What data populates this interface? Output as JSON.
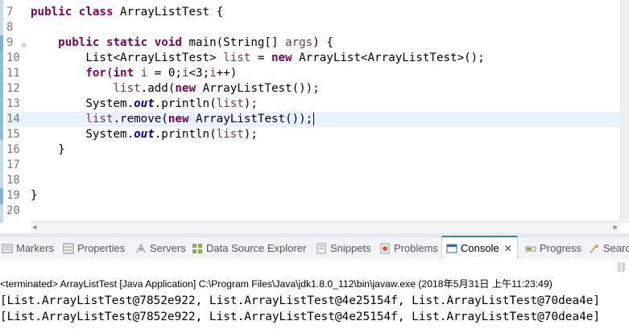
{
  "editor": {
    "lines": [
      {
        "num": "7",
        "segments": [
          {
            "t": "public class ",
            "c": "kw"
          },
          {
            "t": "ArrayListTest {",
            "c": ""
          }
        ]
      },
      {
        "num": "8",
        "segments": []
      },
      {
        "num": "9",
        "segments": [
          {
            "t": "    ",
            "c": ""
          },
          {
            "t": "public static void ",
            "c": "kw"
          },
          {
            "t": "main(String[] ",
            "c": ""
          },
          {
            "t": "args",
            "c": "var"
          },
          {
            "t": ") {",
            "c": ""
          }
        ],
        "fold": "⊖"
      },
      {
        "num": "10",
        "segments": [
          {
            "t": "        List<ArrayListTest> ",
            "c": ""
          },
          {
            "t": "list",
            "c": "var"
          },
          {
            "t": " = ",
            "c": ""
          },
          {
            "t": "new ",
            "c": "kw"
          },
          {
            "t": "ArrayList<ArrayListTest>();",
            "c": ""
          }
        ]
      },
      {
        "num": "11",
        "segments": [
          {
            "t": "        ",
            "c": ""
          },
          {
            "t": "for",
            "c": "kw"
          },
          {
            "t": "(",
            "c": ""
          },
          {
            "t": "int ",
            "c": "kw"
          },
          {
            "t": "i",
            "c": "var"
          },
          {
            "t": " = 0;",
            "c": ""
          },
          {
            "t": "i",
            "c": "var"
          },
          {
            "t": "<3;",
            "c": ""
          },
          {
            "t": "i",
            "c": "var"
          },
          {
            "t": "++)",
            "c": ""
          }
        ]
      },
      {
        "num": "12",
        "segments": [
          {
            "t": "            ",
            "c": ""
          },
          {
            "t": "list",
            "c": "var"
          },
          {
            "t": ".add(",
            "c": ""
          },
          {
            "t": "new ",
            "c": "kw"
          },
          {
            "t": "ArrayListTest());",
            "c": ""
          }
        ]
      },
      {
        "num": "13",
        "segments": [
          {
            "t": "        System.",
            "c": ""
          },
          {
            "t": "out",
            "c": "fld"
          },
          {
            "t": ".println(",
            "c": ""
          },
          {
            "t": "list",
            "c": "var"
          },
          {
            "t": ");",
            "c": ""
          }
        ]
      },
      {
        "num": "14",
        "segments": [
          {
            "t": "        ",
            "c": ""
          },
          {
            "t": "list",
            "c": "var"
          },
          {
            "t": ".remove(",
            "c": ""
          },
          {
            "t": "new ",
            "c": "kw"
          },
          {
            "t": "ArrayListTest());",
            "c": ""
          }
        ],
        "current": true
      },
      {
        "num": "15",
        "segments": [
          {
            "t": "        System.",
            "c": ""
          },
          {
            "t": "out",
            "c": "fld"
          },
          {
            "t": ".println(",
            "c": ""
          },
          {
            "t": "list",
            "c": "var"
          },
          {
            "t": ");",
            "c": ""
          }
        ]
      },
      {
        "num": "16",
        "segments": [
          {
            "t": "    }",
            "c": ""
          }
        ]
      },
      {
        "num": "17",
        "segments": []
      },
      {
        "num": "18",
        "segments": []
      },
      {
        "num": "19",
        "segments": [
          {
            "t": "}",
            "c": ""
          }
        ]
      },
      {
        "num": "20",
        "segments": []
      }
    ]
  },
  "tabs": [
    {
      "label": "Markers",
      "icon": "markers-icon",
      "active": false
    },
    {
      "label": "Properties",
      "icon": "properties-icon",
      "active": false
    },
    {
      "label": "Servers",
      "icon": "servers-icon",
      "active": false
    },
    {
      "label": "Data Source Explorer",
      "icon": "data-source-icon",
      "active": false
    },
    {
      "label": "Snippets",
      "icon": "snippets-icon",
      "active": false
    },
    {
      "label": "Problems",
      "icon": "problems-icon",
      "active": false
    },
    {
      "label": "Console",
      "icon": "console-icon",
      "active": true,
      "close": "✕"
    },
    {
      "label": "Progress",
      "icon": "progress-icon",
      "active": false
    },
    {
      "label": "Searc",
      "icon": "search-icon",
      "active": false
    }
  ],
  "console": {
    "terminated": "<terminated> ArrayListTest [Java Application] C:\\Program Files\\Java\\jdk1.8.0_112\\bin\\javaw.exe (2018年5月31日 上午11:23:49)",
    "output": [
      "[List.ArrayListTest@7852e922, List.ArrayListTest@4e25154f, List.ArrayListTest@70dea4e]",
      "[List.ArrayListTest@7852e922, List.ArrayListTest@4e25154f, List.ArrayListTest@70dea4e]"
    ]
  },
  "colors": {
    "keyword": "#7f0055",
    "static_field": "#0000c0",
    "local_var": "#6a3e3e",
    "current_line": "#e8f2fe",
    "active_tab_border": "#3c7fb1"
  }
}
